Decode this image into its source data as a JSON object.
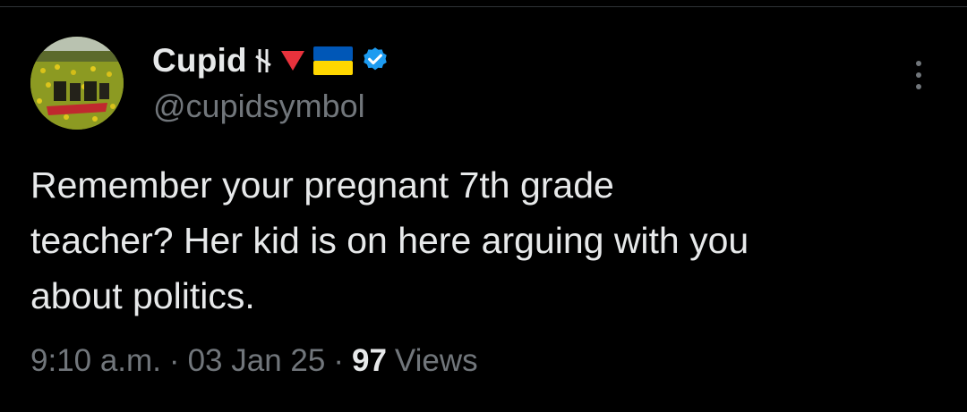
{
  "user": {
    "display_name": "Cupid",
    "name_emojis": [
      "nordic-rune-icon",
      "red-down-triangle-icon",
      "ukraine-flag-icon",
      "verified-badge-icon"
    ],
    "handle": "@cupidsymbol",
    "avatar": "avatar-sunflower-field"
  },
  "tweet": {
    "text": "Remember your pregnant 7th grade\nteacher? Her kid is on here arguing with you\nabout politics.",
    "time": "9:10 a.m.",
    "separator": "·",
    "date": "03 Jan 25",
    "views_count": "97",
    "views_label": "Views"
  },
  "colors": {
    "background": "#000000",
    "primary_text": "#e7e9ea",
    "secondary_text": "#71767b",
    "verified_blue": "#1d9bf0",
    "flag_blue": "#0057b7",
    "flag_yellow": "#ffd700",
    "red_triangle": "#e8323c"
  },
  "icons": {
    "more_button": "more-options-icon"
  }
}
